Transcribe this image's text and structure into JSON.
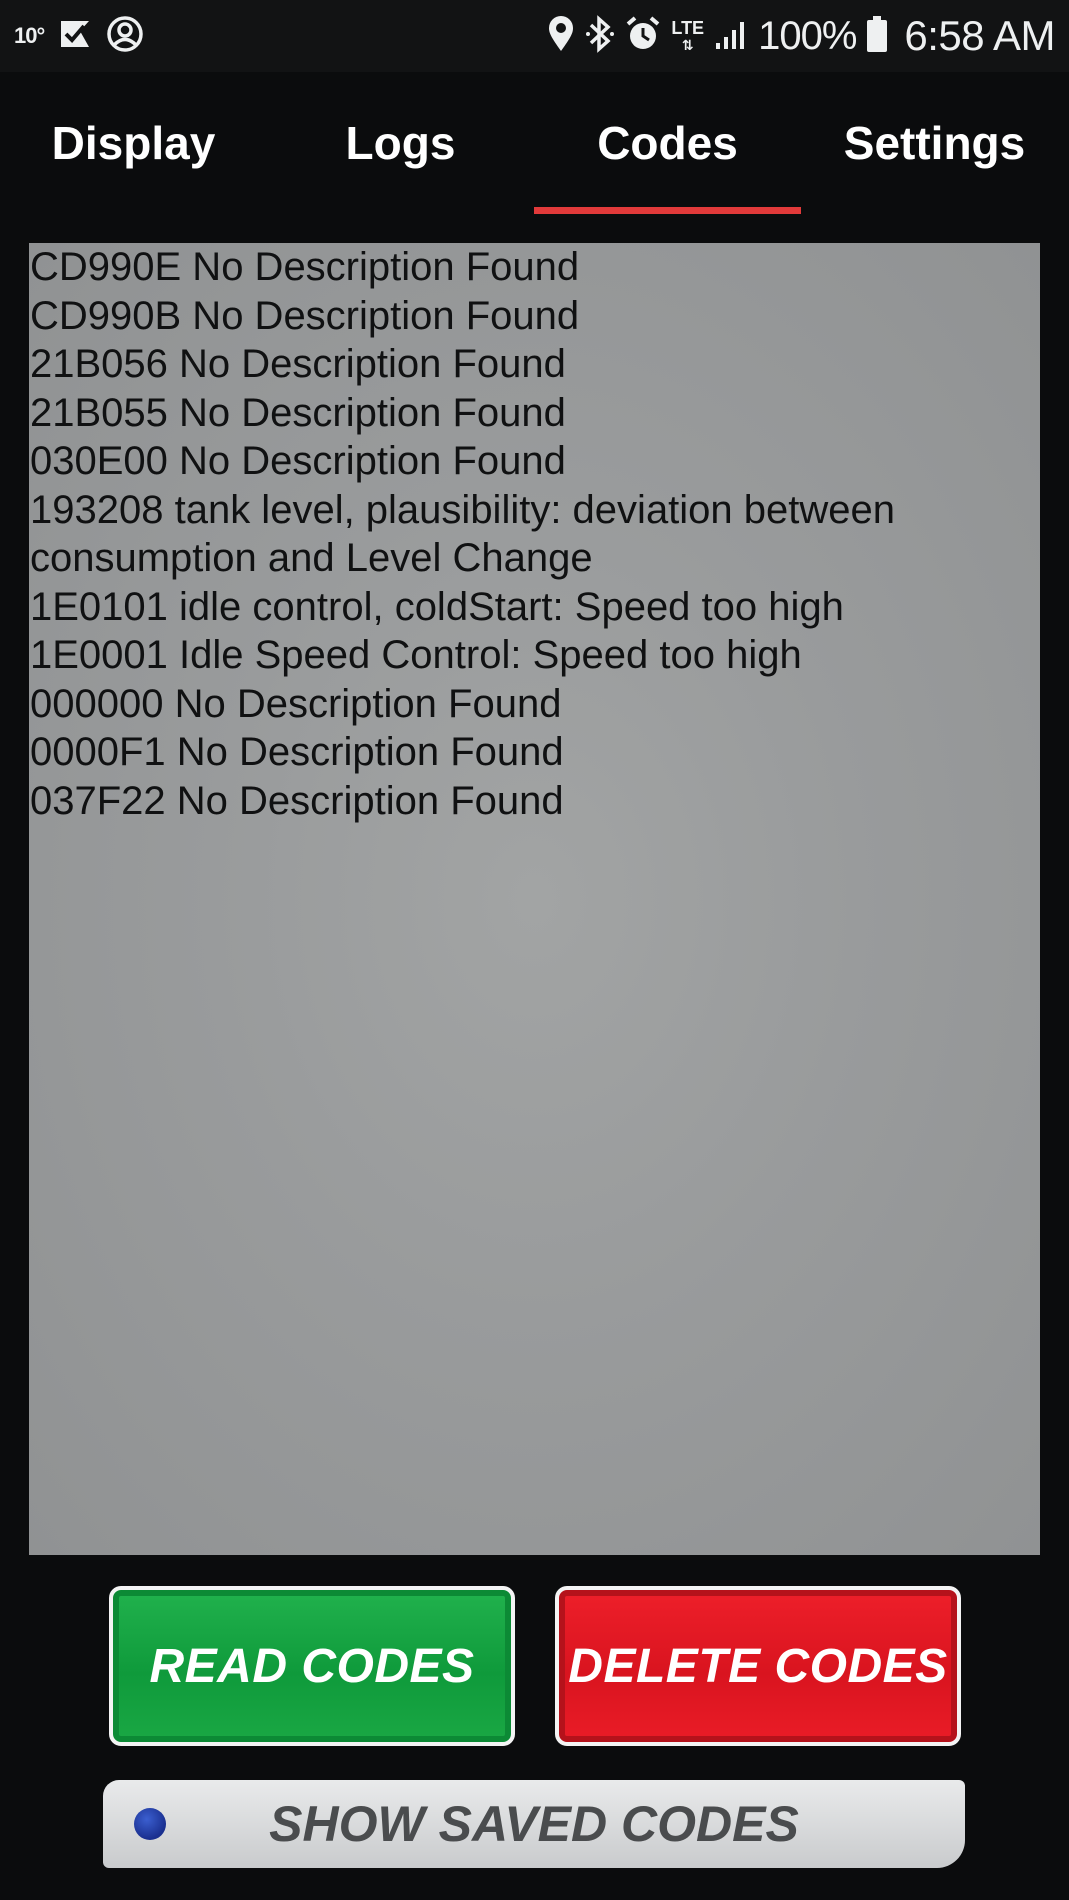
{
  "status_bar": {
    "temperature": "10°",
    "network": "LTE",
    "battery": "100%",
    "time": "6:58 AM",
    "icons": [
      "messages-check-icon",
      "account-icon",
      "location-icon",
      "bluetooth-icon",
      "alarm-icon",
      "lte-icon",
      "signal-icon",
      "battery-icon"
    ]
  },
  "tabs": [
    {
      "label": "Display",
      "active": false
    },
    {
      "label": "Logs",
      "active": false
    },
    {
      "label": "Codes",
      "active": true
    },
    {
      "label": "Settings",
      "active": false
    }
  ],
  "codes": [
    "CD990E No Description Found",
    "CD990B No Description Found",
    "21B056 No Description Found",
    "21B055 No Description Found",
    "030E00 No Description Found",
    "193208 tank level, plausibility: deviation between consumption and Level Change",
    "1E0101 idle control, coldStart: Speed too high",
    "1E0001 Idle Speed Control: Speed too high",
    "000000 No Description Found",
    "0000F1 No Description Found",
    "037F22 No Description Found"
  ],
  "buttons": {
    "read": "READ CODES",
    "delete": "DELETE CODES",
    "show_saved": "SHOW SAVED CODES"
  },
  "colors": {
    "accent": "#e23a3a",
    "read_button": "#13a040",
    "delete_button": "#e81b26",
    "panel": "#999b9c"
  }
}
